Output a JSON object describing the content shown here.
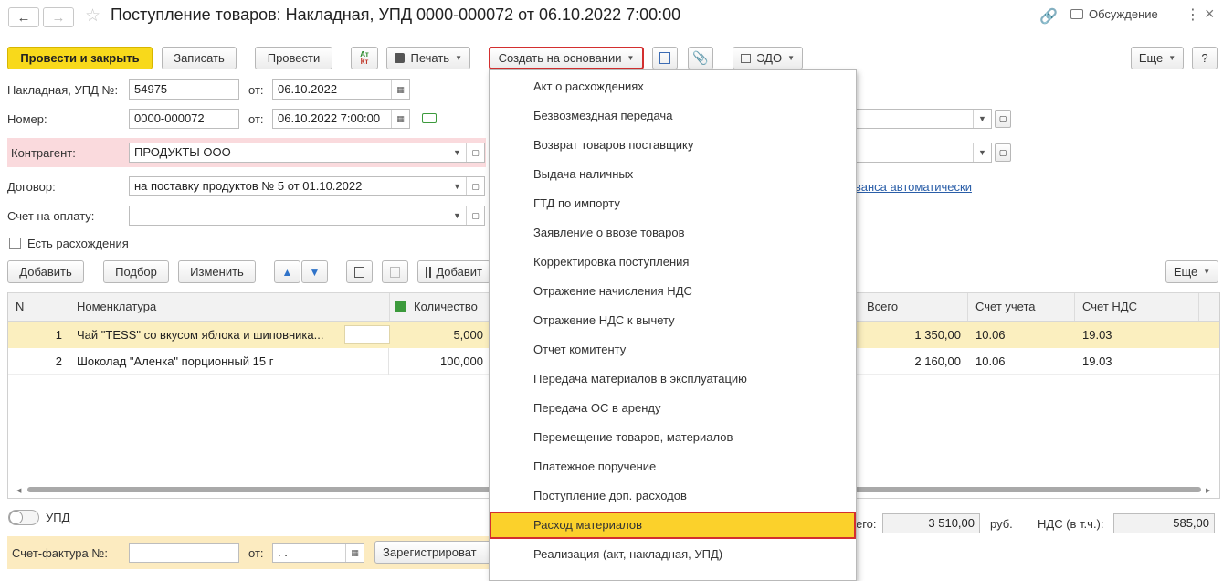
{
  "window": {
    "title": "Поступление товаров: Накладная, УПД 0000-000072 от 06.10.2022 7:00:00",
    "discussion_label": "Обсуждение"
  },
  "toolbar": {
    "post_close": "Провести и закрыть",
    "save": "Записать",
    "post": "Провести",
    "dtkt": "Дт Кт",
    "print": "Печать",
    "create_based": "Создать на основании",
    "edo": "ЭДО",
    "more": "Еще",
    "help": "?"
  },
  "form": {
    "invoice_label": "Накладная, УПД №:",
    "invoice_value": "54975",
    "from_label": "от:",
    "invoice_date": "06.10.2022",
    "number_label": "Номер:",
    "number_value": "0000-000072",
    "number_date": "06.10.2022  7:00:00",
    "counterparty_label": "Контрагент:",
    "counterparty_value": "ПРОДУКТЫ ООО",
    "contract_label": "Договор:",
    "contract_value": "на поставку продуктов № 5 от 01.10.2022",
    "contract_link_fragment": "ванса автоматически",
    "payment_label": "Счет на оплату:",
    "payment_value": "",
    "discrepancy_label": "Есть расхождения"
  },
  "table_toolbar": {
    "add": "Добавить",
    "pick": "Подбор",
    "edit": "Изменить",
    "add2": "Добавит",
    "more": "Еще"
  },
  "table": {
    "columns": [
      "N",
      "Номенклатура",
      "Количество",
      "Всего",
      "Счет учета",
      "Счет НДС"
    ],
    "rows": [
      {
        "n": "1",
        "name": "Чай \"TESS\" со вкусом яблока и шиповника...",
        "qty": "5,000",
        "total": "1 350,00",
        "account": "10.06",
        "vat_account": "19.03"
      },
      {
        "n": "2",
        "name": "Шоколад \"Аленка\" порционный 15 г",
        "qty": "100,000",
        "total": "2 160,00",
        "account": "10.06",
        "vat_account": "19.03"
      }
    ]
  },
  "footer": {
    "upd_label": "УПД",
    "total_fragment": "его:",
    "total_value": "3 510,00",
    "currency": "руб.",
    "vat_label": "НДС (в т.ч.):",
    "vat_value": "585,00",
    "sf_label": "Счет-фактура №:",
    "sf_from": "от:",
    "sf_date": ".  .",
    "register": "Зарегистрироват"
  },
  "dropdown_menu": {
    "items": [
      "Акт о расхождениях",
      "Безвозмездная передача",
      "Возврат товаров поставщику",
      "Выдача наличных",
      "ГТД по импорту",
      "Заявление о ввозе товаров",
      "Корректировка поступления",
      "Отражение начисления НДС",
      "Отражение НДС к вычету",
      "Отчет комитенту",
      "Передача материалов в эксплуатацию",
      "Передача ОС в аренду",
      "Перемещение товаров, материалов",
      "Платежное поручение",
      "Поступление доп. расходов",
      "Расход материалов",
      "Реализация (акт, накладная, УПД)"
    ],
    "highlighted_index": 15
  },
  "colors": {
    "accent_yellow": "#f8d91b",
    "highlight_border": "#d32f2f",
    "selected_row": "#fbefbf",
    "counterparty_bg": "#fadadd",
    "footer_bg": "#fcebc0",
    "link": "#2a5ea8"
  }
}
